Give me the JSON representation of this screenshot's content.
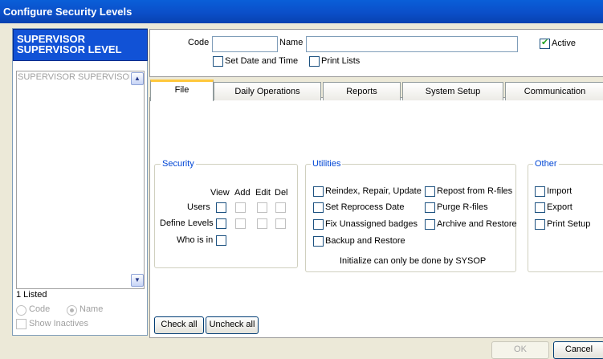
{
  "window": {
    "title": "Configure Security Levels"
  },
  "left_panel": {
    "selected_line1": "SUPERVISOR",
    "selected_line2": "SUPERVISOR LEVEL",
    "list_items": [
      "SUPERVISOR  SUPERVISOR LEVEL"
    ],
    "count_label": "1 Listed",
    "sort_code_label": "Code",
    "sort_name_label": "Name",
    "sort_selected": "Name",
    "show_inactives_label": "Show Inactives"
  },
  "header": {
    "code_label": "Code",
    "code_value": "",
    "name_label": "Name",
    "name_value": "",
    "active_label": "Active",
    "active_checked": true,
    "set_date_time_label": "Set Date and Time",
    "print_lists_label": "Print Lists"
  },
  "tabs": [
    {
      "label": "File",
      "active": true
    },
    {
      "label": "Daily Operations",
      "active": false
    },
    {
      "label": "Reports",
      "active": false
    },
    {
      "label": "System Setup",
      "active": false
    },
    {
      "label": "Communication",
      "active": false
    }
  ],
  "security": {
    "title": "Security",
    "col_headers": [
      "View",
      "Add",
      "Edit",
      "Del"
    ],
    "rows": [
      "Users",
      "Define Levels",
      "Who is in"
    ]
  },
  "utilities": {
    "title": "Utilities",
    "items_left": [
      "Reindex, Repair, Update",
      "Set Reprocess Date",
      "Fix Unassigned badges",
      "Backup and Restore"
    ],
    "items_right": [
      "Repost from R-files",
      "Purge R-files",
      "Archive and Restore"
    ],
    "note": "Initialize can only be done by SYSOP"
  },
  "other": {
    "title": "Other",
    "items": [
      "Import",
      "Export",
      "Print Setup"
    ]
  },
  "buttons": {
    "check_all": "Check all",
    "uncheck_all": "Uncheck all",
    "ok": "OK",
    "cancel": "Cancel"
  },
  "icons": {
    "scroll_up": "chevron-up-icon",
    "scroll_down": "chevron-down-icon",
    "checkmark": "checkmark-icon"
  }
}
